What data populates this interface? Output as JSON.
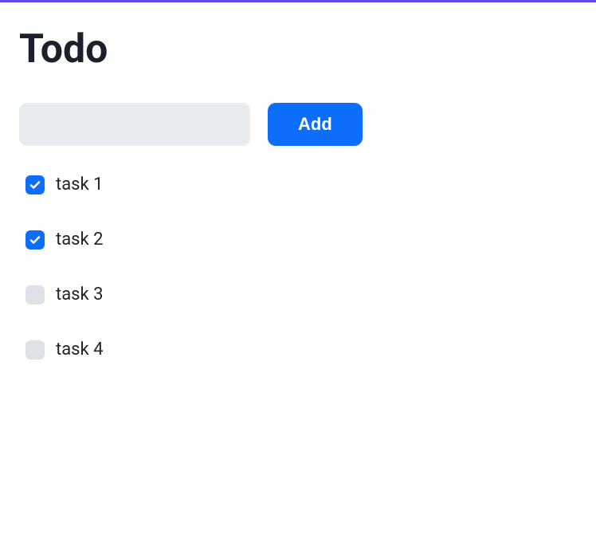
{
  "header": {
    "title": "Todo"
  },
  "input": {
    "value": "",
    "placeholder": ""
  },
  "buttons": {
    "add_label": "Add"
  },
  "tasks": [
    {
      "label": "task 1",
      "completed": true
    },
    {
      "label": "task 2",
      "completed": true
    },
    {
      "label": "task 3",
      "completed": false
    },
    {
      "label": "task 4",
      "completed": false
    }
  ],
  "colors": {
    "accent": "#0d6efd",
    "top_border": "#6246ea",
    "input_bg": "#e9ecef",
    "unchecked_bg": "#dee2e6"
  }
}
